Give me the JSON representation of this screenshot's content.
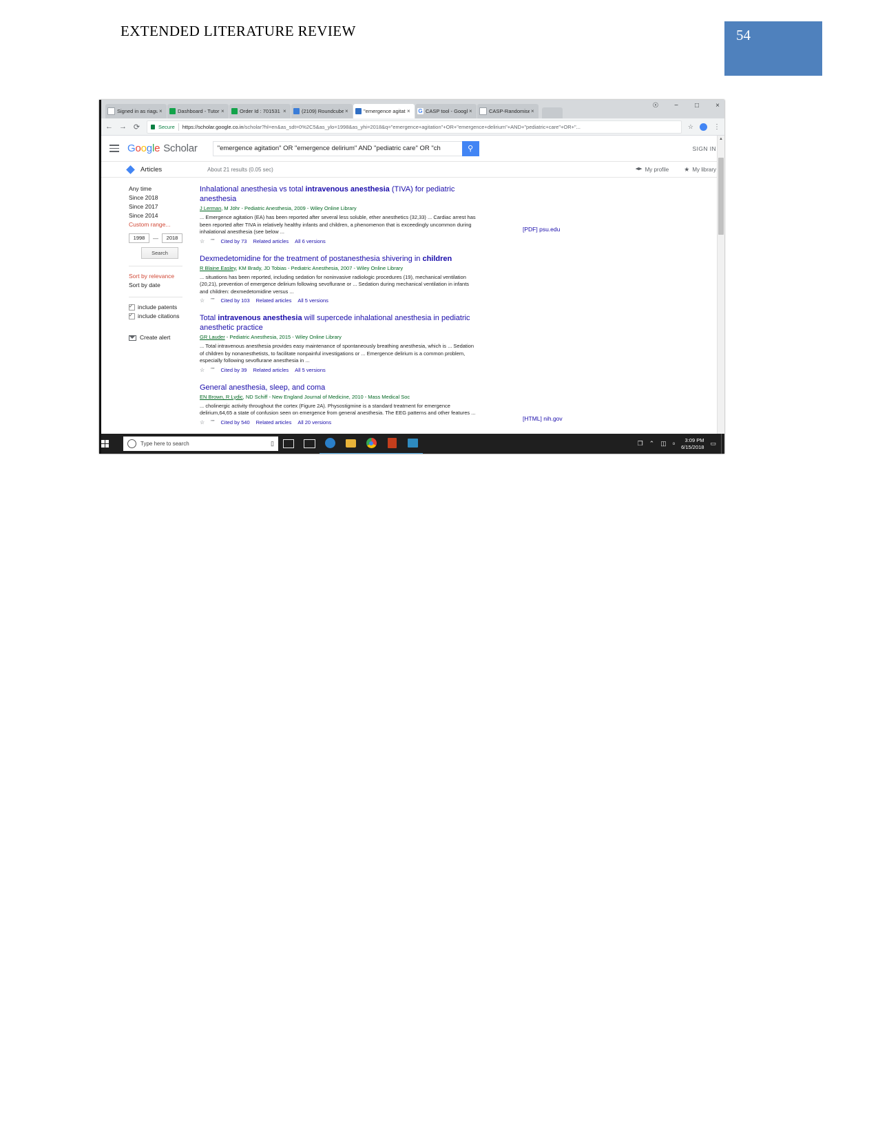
{
  "page": {
    "header_title": "EXTENDED LITERATURE REVIEW",
    "page_number": "54",
    "accent_color": "#4f81bd"
  },
  "browser": {
    "tabs": [
      {
        "label": "Signed in as riagup",
        "favicon": "page-icon",
        "close": "×",
        "active": false
      },
      {
        "label": "Dashboard - Tutor",
        "favicon": "green-icon",
        "close": "×",
        "active": false
      },
      {
        "label": "Order Id : 701531",
        "favicon": "green-icon",
        "close": "×",
        "active": false
      },
      {
        "label": "(2109) Roundcube",
        "favicon": "blue-circle-icon",
        "close": "×",
        "active": false
      },
      {
        "label": "\"emergence agitat",
        "favicon": "scholar-icon",
        "close": "×",
        "active": true
      },
      {
        "label": "CASP tool - Googl",
        "favicon": "google-g-icon",
        "close": "×",
        "active": false
      },
      {
        "label": "CASP-Randomise",
        "favicon": "page-icon",
        "close": "×",
        "active": false
      }
    ],
    "window_controls": {
      "minimize": "−",
      "maximize": "□",
      "close": "×"
    },
    "nav": {
      "back": "←",
      "forward": "→",
      "reload": "⟳"
    },
    "omnibox": {
      "secure_label": "Secure",
      "url_domain": "https://scholar.google.co.in",
      "url_path": "/scholar?hl=en&as_sdt=0%2C5&as_ylo=1998&as_yhi=2018&q=\"emergence+agitation\"+OR+\"emergence+delirium\"+AND+\"pediatric+care\"+OR+\"...",
      "star": "☆",
      "menu": "⋮"
    }
  },
  "scholar": {
    "logo_word1": "Google",
    "logo_word2": "Scholar",
    "search_value": "\"emergence agitation\" OR \"emergence delirium\" AND \"pediatric care\" OR \"ch",
    "search_button_icon": "search-icon",
    "sign_in": "SIGN IN",
    "articles_label": "Articles",
    "result_count": "About 21 results (0.05 sec)",
    "my_profile": "My profile",
    "my_library": "My library",
    "sidebar": {
      "time_filters": [
        "Any time",
        "Since 2018",
        "Since 2017",
        "Since 2014"
      ],
      "custom_range": "Custom range...",
      "range_from": "1998",
      "range_dash": "—",
      "range_to": "2018",
      "range_search_button": "Search",
      "sort_relevance": "Sort by relevance",
      "sort_date": "Sort by date",
      "include_patents": "include patents",
      "include_citations": "include citations",
      "create_alert": "Create alert"
    },
    "results": [
      {
        "title_plain_1": "Inhalational anesthesia vs total ",
        "title_bold": "intravenous anesthesia",
        "title_plain_2": " (TIVA) for pediatric anesthesia",
        "meta_authors": "J Lerman",
        "meta_rest": ", M Jöhr - Pediatric Anesthesia, 2009 - Wiley Online Library",
        "snippet": "... Emergence agitation (EA) has been reported after several less soluble, ether anesthetics (32,33) ... Cardiac arrest has been reported after TIVA in relatively healthy infants and children, a phenomenon that is exceedingly uncommon during inhalational anesthesia (see below ...",
        "star_icon": "☆",
        "quote_icon": "””",
        "cited_by": "Cited by 73",
        "related": "Related articles",
        "versions": "All 6 versions",
        "side_link_tag": "[PDF]",
        "side_link_host": " psu.edu"
      },
      {
        "title_plain_1": "Dexmedetomidine for the treatment of postanesthesia shivering in ",
        "title_bold": "children",
        "title_plain_2": "",
        "meta_authors": "R Blaine Easley",
        "meta_rest": ", KM Brady, JD Tobias - Pediatric Anesthesia, 2007 - Wiley Online Library",
        "snippet": "... situations has been reported, including sedation for noninvasive radiologic procedures (19), mechanical ventilation (20,21), prevention of emergence delirium following sevoflurane or ... Sedation during mechanical ventilation in infants and children: dexmedetomidine versus ...",
        "star_icon": "☆",
        "quote_icon": "””",
        "cited_by": "Cited by 103",
        "related": "Related articles",
        "versions": "All 5 versions",
        "side_link_tag": "",
        "side_link_host": ""
      },
      {
        "title_plain_1": "Total ",
        "title_bold": "intravenous anesthesia",
        "title_plain_2": " will supercede inhalational anesthesia in pediatric anesthetic practice",
        "meta_authors": "GR Lauder",
        "meta_rest": " - Pediatric Anesthesia, 2015 - Wiley Online Library",
        "snippet": "... Total intravenous anesthesia provides easy maintenance of spontaneously breathing anesthesia, which is ... Sedation of children by nonanesthetists, to facilitate nonpainful investigations or ... Emergence delirium is a common problem, especially following sevoflurane anesthesia in ...",
        "star_icon": "☆",
        "quote_icon": "””",
        "cited_by": "Cited by 39",
        "related": "Related articles",
        "versions": "All 5 versions",
        "side_link_tag": "",
        "side_link_host": ""
      },
      {
        "title_plain_1": "General anesthesia, sleep, and coma",
        "title_bold": "",
        "title_plain_2": "",
        "meta_authors": "EN Brown, R Lydic",
        "meta_rest": ", ND Schiff - New England Journal of Medicine, 2010 - Mass Medical Soc",
        "snippet": "... cholinergic activity throughout the cortex (Figure 2A). Physostigmine is a standard treatment for emergence delirium,64,65 a state of confusion seen on emergence from general anesthesia. The EEG patterns and other features ...",
        "star_icon": "☆",
        "quote_icon": "””",
        "cited_by": "Cited by 540",
        "related": "Related articles",
        "versions": "All 20 versions",
        "side_link_tag": "[HTML]",
        "side_link_host": " nih.gov"
      }
    ]
  },
  "taskbar": {
    "search_placeholder": "Type here to search",
    "mic_icon": "⬚",
    "icons": [
      "task-view-icon",
      "mail-icon",
      "edge-icon",
      "file-explorer-icon",
      "chrome-icon",
      "word-icon",
      "app-icon"
    ],
    "tray": {
      "pin": "❐",
      "chevron": "⌃",
      "network": "◫",
      "volume": "ᵒ",
      "time": "3:09 PM",
      "date": "6/15/2018",
      "notifications": "▭"
    }
  }
}
